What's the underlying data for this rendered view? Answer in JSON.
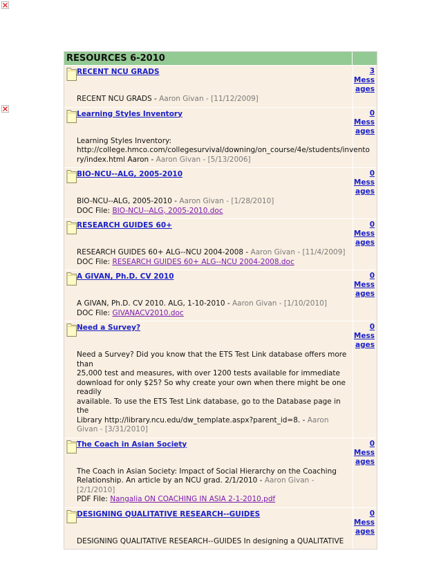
{
  "page": {
    "title": "RESOURCES 6-2010",
    "count_suffix": "Messages"
  },
  "items": [
    {
      "title": "RECENT NCU GRADS",
      "count": "3",
      "count_lines": [
        "Mess",
        "ages"
      ],
      "desc_lines": [
        "RECENT NCU GRADS - "
      ],
      "meta": "Aaron Givan - [11/12/2009]",
      "file_label": "",
      "file_name": ""
    },
    {
      "title": "Learning Styles Inventory",
      "count": "0",
      "count_lines": [
        "Mess",
        "ages"
      ],
      "desc_lines": [
        "Learning Styles Inventory:",
        "http://college.hmco.com/collegesurvival/downing/on_course/4e/students/invento",
        "ry/index.html Aaron - "
      ],
      "meta": "Aaron Givan - [5/13/2006]",
      "file_label": "",
      "file_name": ""
    },
    {
      "title": "BIO-NCU--ALG, 2005-2010",
      "count": "0",
      "count_lines": [
        "Mess",
        "ages"
      ],
      "desc_lines": [
        "BIO-NCU--ALG, 2005-2010 - "
      ],
      "meta": "Aaron Givan - [1/28/2010]",
      "file_label": "DOC File: ",
      "file_name": "BIO-NCU--ALG, 2005-2010.doc"
    },
    {
      "title": "RESEARCH GUIDES 60+",
      "count": "0",
      "count_lines": [
        "Mess",
        "ages"
      ],
      "desc_lines": [
        "RESEARCH GUIDES 60+ ALG--NCU 2004-2008 - "
      ],
      "meta": "Aaron Givan - [11/4/2009]",
      "file_label": "DOC File: ",
      "file_name": "RESEARCH GUIDES 60+ ALG--NCU 2004-2008.doc"
    },
    {
      "title": "A GIVAN, Ph.D. CV 2010",
      "count": "0",
      "count_lines": [
        "Mess",
        "ages"
      ],
      "desc_lines": [
        "A GIVAN, Ph.D. CV 2010. ALG, 1-10-2010 - "
      ],
      "meta": "Aaron Givan - [1/10/2010]",
      "file_label": "DOC File: ",
      "file_name": "GIVANACV2010.doc"
    },
    {
      "title": "Need a Survey?",
      "count": "0",
      "count_lines": [
        "Mess",
        "ages"
      ],
      "desc_lines": [
        "Need a Survey? Did you know that the ETS Test Link database offers more than",
        "25,000 test and measures, with over 1200 tests available for immediate",
        "download for only $25? So why create your own when there might be one readily",
        "available. To use the ETS Test Link database, go to the Database page in the",
        "Library http://library.ncu.edu/dw_template.aspx?parent_id=8.  - "
      ],
      "meta": "Aaron Givan - [3/31/2010]",
      "file_label": "",
      "file_name": ""
    },
    {
      "title": "The Coach in Asian Society",
      "count": "0",
      "count_lines": [
        "Mess",
        "ages"
      ],
      "desc_lines": [
        "The Coach in Asian Society: Impact of Social Hierarchy on the Coaching",
        "Relationship. An article by an NCU grad. 2/1/2010 - "
      ],
      "meta": "Aaron Givan - [2/1/2010]",
      "file_label": "PDF File: ",
      "file_name": "Nangalia ON COACHING IN ASIA 2-1-2010.pdf"
    },
    {
      "title": "DESIGNING QUALITATIVE RESEARCH--GUIDES",
      "count": "0",
      "count_lines": [
        "Mess",
        "ages"
      ],
      "desc_lines": [
        "DESIGNING QUALITATIVE RESEARCH--GUIDES In designing a QUALITATIVE"
      ],
      "meta": "",
      "file_label": "",
      "file_name": ""
    }
  ],
  "colors": {
    "header_bg": "#93c993",
    "row_bg": "#f9efe2",
    "link": "#1a21c8",
    "file_link": "#7a1ab0",
    "meta_text": "#7a7a7a"
  }
}
